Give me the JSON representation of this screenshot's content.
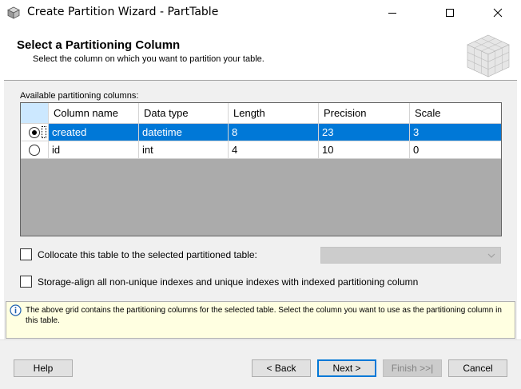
{
  "window": {
    "title": "Create Partition Wizard - PartTable",
    "icons": [
      "app-cube-icon",
      "minimize-icon",
      "maximize-icon",
      "close-icon"
    ]
  },
  "header": {
    "title": "Select a Partitioning Column",
    "subtitle": "Select the column on which you want to partition your table."
  },
  "grid": {
    "label": "Available partitioning columns:",
    "columns": [
      "Column name",
      "Data type",
      "Length",
      "Precision",
      "Scale"
    ],
    "rows": [
      {
        "selected": true,
        "name": "created",
        "type": "datetime",
        "length": "8",
        "precision": "23",
        "scale": "3"
      },
      {
        "selected": false,
        "name": "id",
        "type": "int",
        "length": "4",
        "precision": "10",
        "scale": "0"
      }
    ]
  },
  "options": {
    "collocate_label": "Collocate this table to the selected partitioned table:",
    "collocate_checked": false,
    "collocate_combo_value": "",
    "storage_align_label": "Storage-align all non-unique indexes and unique indexes with indexed partitioning column",
    "storage_align_checked": false
  },
  "info": {
    "text": "The above grid contains the partitioning columns for the selected table. Select the column you want to use as the partitioning column in this table."
  },
  "buttons": {
    "help": "Help",
    "back": "< Back",
    "next": "Next >",
    "finish": "Finish >>|",
    "cancel": "Cancel"
  },
  "colors": {
    "selection": "#0078d7",
    "info_bg": "#ffffe1",
    "panel_bg": "#f0f0f0"
  }
}
